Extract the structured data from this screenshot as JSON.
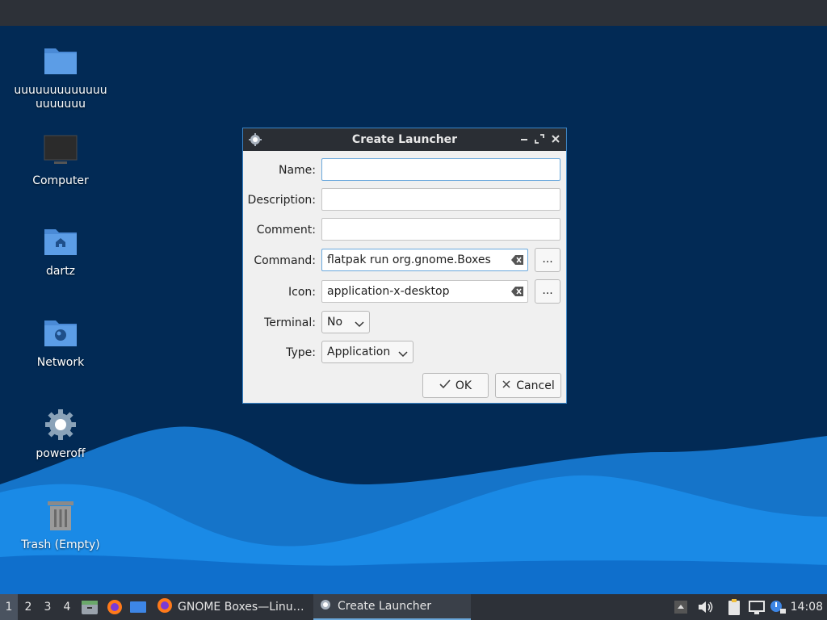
{
  "desktop": {
    "icons": [
      {
        "label": "uuuuuuuuuuuuuuuuuuuu",
        "icon": "folder-icon"
      },
      {
        "label": "Computer",
        "icon": "computer-icon"
      },
      {
        "label": "dartz",
        "icon": "home-folder-icon"
      },
      {
        "label": "Network",
        "icon": "network-folder-icon"
      },
      {
        "label": "poweroff",
        "icon": "gear-icon"
      },
      {
        "label": "Trash (Empty)",
        "icon": "trash-icon"
      }
    ]
  },
  "dialog": {
    "title": "Create Launcher",
    "fields": {
      "name": {
        "label": "Name:",
        "value": ""
      },
      "description": {
        "label": "Description:",
        "value": ""
      },
      "comment": {
        "label": "Comment:",
        "value": ""
      },
      "command": {
        "label": "Command:",
        "value": "flatpak run org.gnome.Boxes"
      },
      "icon": {
        "label": "Icon:",
        "value": "application-x-desktop"
      },
      "terminal": {
        "label": "Terminal:",
        "value": "No"
      },
      "type": {
        "label": "Type:",
        "value": "Application"
      }
    },
    "browse_label": "...",
    "ok_label": "OK",
    "cancel_label": "Cancel"
  },
  "taskbar": {
    "workspaces": [
      "1",
      "2",
      "3",
      "4"
    ],
    "active_workspace": "1",
    "tasks": [
      {
        "label": "GNOME Boxes—Linu…",
        "icon": "firefox-icon"
      },
      {
        "label": "Create Launcher",
        "icon": "gear-icon"
      }
    ],
    "clock": "14:08"
  },
  "colors": {
    "accent": "#3d86c6",
    "panel": "#2d3138",
    "desktop_bg": "#022a55",
    "wave": "#1a8ae6"
  }
}
